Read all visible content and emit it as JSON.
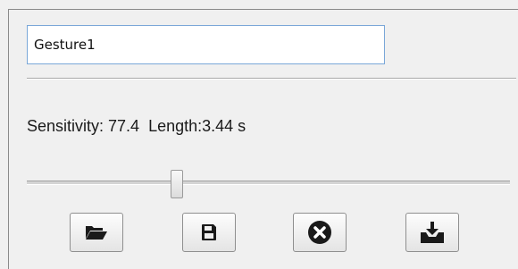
{
  "gesture": {
    "name_value": "Gesture1"
  },
  "stats": {
    "info_text": "Sensitivity: 77.4  Length:3.44 s"
  },
  "slider": {
    "position_fraction": 0.31
  },
  "toolbar": {
    "buttons": [
      {
        "icon": "folder-open-icon"
      },
      {
        "icon": "save-icon"
      },
      {
        "icon": "close-circle-icon"
      },
      {
        "icon": "download-tray-icon"
      }
    ]
  }
}
